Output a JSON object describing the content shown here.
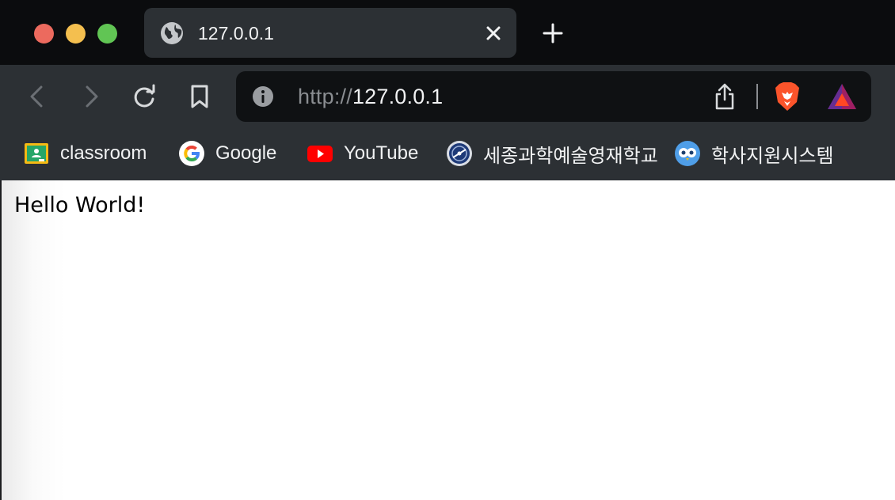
{
  "tab": {
    "title": "127.0.0.1",
    "icon": "globe-icon"
  },
  "window_controls": {
    "close": "#ec6a5e",
    "minimize": "#f4bf4f",
    "zoom": "#61c554"
  },
  "address_bar": {
    "scheme": "http://",
    "host": "127.0.0.1"
  },
  "bookmarks": [
    {
      "label": "classroom",
      "icon": "google-classroom-icon"
    },
    {
      "label": "Google",
      "icon": "google-icon"
    },
    {
      "label": "YouTube",
      "icon": "youtube-icon"
    },
    {
      "label": "세종과학예술영재학교",
      "icon": "school-emblem-icon"
    },
    {
      "label": "학사지원시스템",
      "icon": "owl-icon"
    }
  ],
  "page": {
    "text": "Hello World!"
  },
  "colors": {
    "accent_brave": "#fb542b",
    "toolbar": "#2c3034",
    "tabstrip": "#0b0c0e"
  }
}
